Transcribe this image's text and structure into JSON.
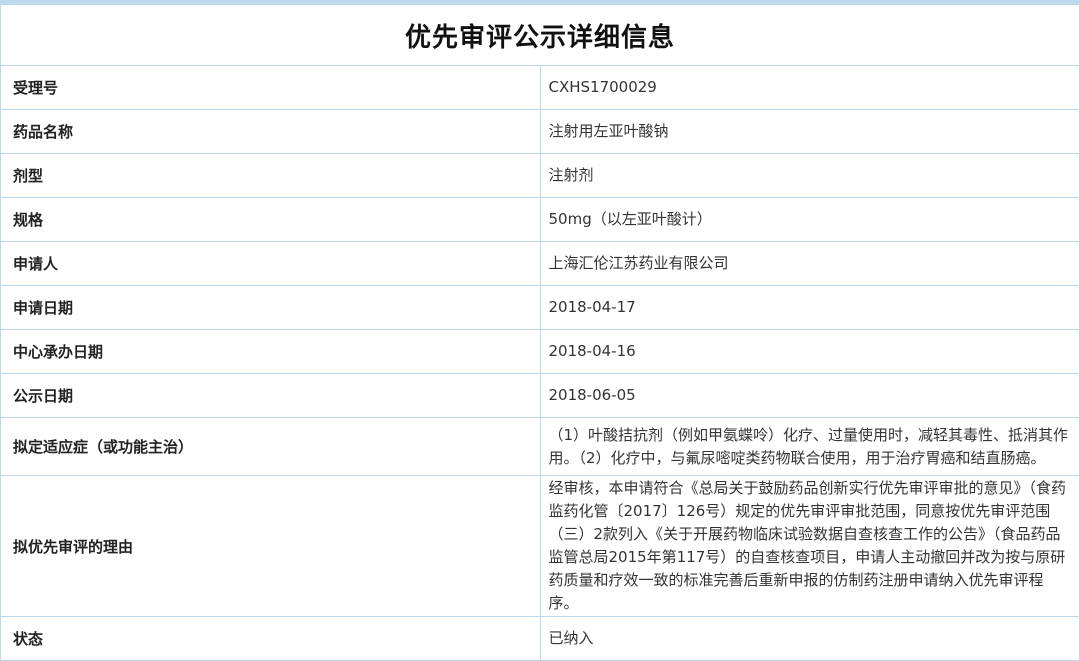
{
  "title": "优先审评公示详细信息",
  "rows": [
    {
      "label": "受理号",
      "value": "CXHS1700029"
    },
    {
      "label": "药品名称",
      "value": "注射用左亚叶酸钠"
    },
    {
      "label": "剂型",
      "value": "注射剂"
    },
    {
      "label": "规格",
      "value": "50mg（以左亚叶酸计）"
    },
    {
      "label": "申请人",
      "value": "上海汇伦江苏药业有限公司"
    },
    {
      "label": "申请日期",
      "value": "2018-04-17"
    },
    {
      "label": "中心承办日期",
      "value": "2018-04-16"
    },
    {
      "label": "公示日期",
      "value": "2018-06-05"
    },
    {
      "label": "拟定适应症（或功能主治）",
      "value": "（1）叶酸拮抗剂（例如甲氨蝶呤）化疗、过量使用时，减轻其毒性、抵消其作用。（2）化疗中，与氟尿嘧啶类药物联合使用，用于治疗胃癌和结直肠癌。"
    },
    {
      "label": "拟优先审评的理由",
      "value": "经审核，本申请符合《总局关于鼓励药品创新实行优先审评审批的意见》（食药监药化管〔2017〕126号）规定的优先审评审批范围，同意按优先审评范围（三）2款列入《关于开展药物临床试验数据自查核查工作的公告》（食品药品监管总局2015年第117号）的自查核查项目，申请人主动撤回并改为按与原研药质量和疗效一致的标准完善后重新申报的仿制药注册申请纳入优先审评程序。"
    },
    {
      "label": "状态",
      "value": "已纳入"
    }
  ]
}
